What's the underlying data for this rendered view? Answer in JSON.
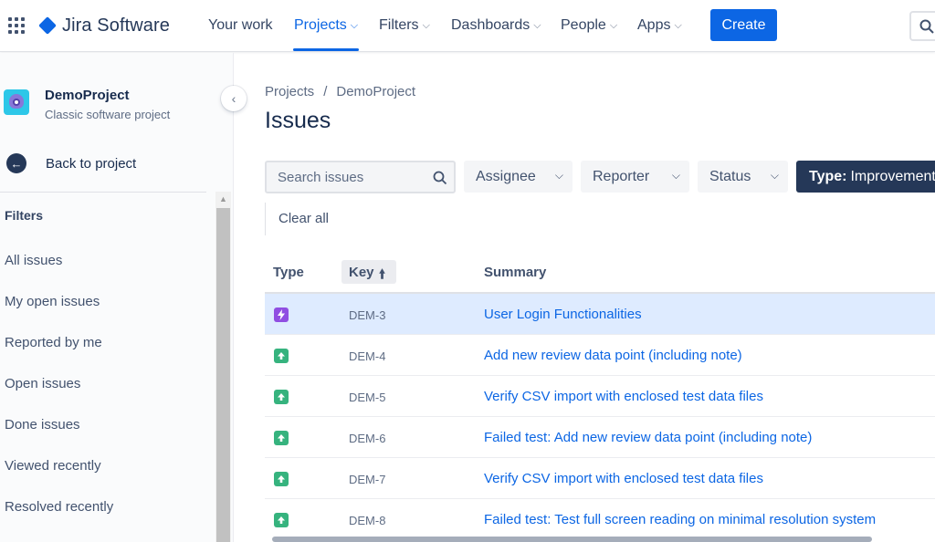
{
  "topnav": {
    "brand": "Jira Software",
    "items": [
      {
        "label": "Your work",
        "dropdown": false
      },
      {
        "label": "Projects",
        "dropdown": true,
        "active": true
      },
      {
        "label": "Filters",
        "dropdown": true
      },
      {
        "label": "Dashboards",
        "dropdown": true
      },
      {
        "label": "People",
        "dropdown": true
      },
      {
        "label": "Apps",
        "dropdown": true
      }
    ],
    "create_label": "Create",
    "icons": {
      "apps": "grid-icon",
      "brand": "diamond-logo-icon",
      "search": "search-icon"
    },
    "accent_color": "#0c66e4"
  },
  "sidebar": {
    "project_name": "DemoProject",
    "project_type": "Classic software project",
    "collapse_icon": "chevron-left-icon",
    "back_label": "Back to project",
    "filters_heading": "Filters",
    "links": [
      "All issues",
      "My open issues",
      "Reported by me",
      "Open issues",
      "Done issues",
      "Viewed recently",
      "Resolved recently"
    ]
  },
  "main": {
    "breadcrumb": [
      "Projects",
      "DemoProject"
    ],
    "breadcrumb_separator": "/",
    "title": "Issues",
    "search": {
      "placeholder": "Search issues",
      "value": ""
    },
    "filters": {
      "assignee": "Assignee",
      "reporter": "Reporter",
      "status": "Status",
      "type_prefix": "Type:",
      "type_value": "Improvement"
    },
    "clear_all": "Clear all",
    "columns": {
      "type": "Type",
      "key": "Key",
      "key_sort_icon": "arrow-up-icon",
      "summary": "Summary"
    },
    "rows": [
      {
        "type": "epic",
        "key": "DEM-3",
        "summary": "User Login Functionalities",
        "selected": true
      },
      {
        "type": "improvement",
        "key": "DEM-4",
        "summary": "Add new review data point (including note)"
      },
      {
        "type": "improvement",
        "key": "DEM-5",
        "summary": "Verify CSV import with enclosed test data files"
      },
      {
        "type": "improvement",
        "key": "DEM-6",
        "summary": "Failed test: Add new review data point (including note)"
      },
      {
        "type": "improvement",
        "key": "DEM-7",
        "summary": "Verify CSV import with enclosed test data files"
      },
      {
        "type": "improvement",
        "key": "DEM-8",
        "summary": "Failed test: Test full screen reading on minimal resolution system"
      }
    ],
    "colors": {
      "epic": "#904ee2",
      "improvement": "#36b37e",
      "selected_row": "#deebff",
      "link": "#0c66e4"
    }
  }
}
